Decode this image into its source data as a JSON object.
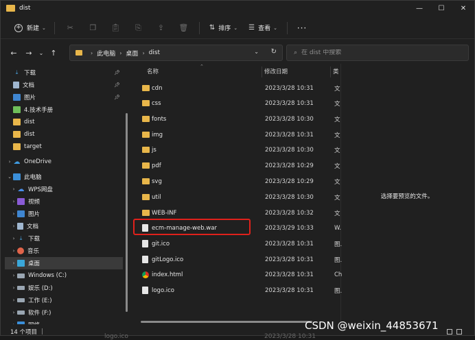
{
  "window": {
    "title": "dist",
    "controls": {
      "minimize": "—",
      "maximize": "☐",
      "close": "✕"
    }
  },
  "toolbar": {
    "new_label": "新建",
    "sort_label": "排序",
    "view_label": "查看",
    "more_label": "···"
  },
  "navigation": {
    "breadcrumb": [
      "此电脑",
      "桌面",
      "dist"
    ],
    "search_placeholder": "在 dist 中搜索"
  },
  "sidebar": {
    "quick_access": [
      {
        "label": "下载",
        "pinned": true
      },
      {
        "label": "文档",
        "pinned": true
      },
      {
        "label": "图片",
        "pinned": true
      },
      {
        "label": "4.技术手册",
        "pinned": false
      },
      {
        "label": "dist",
        "pinned": false
      },
      {
        "label": "dist",
        "pinned": false
      },
      {
        "label": "target",
        "pinned": false
      }
    ],
    "onedrive": "OneDrive",
    "this_pc": "此电脑",
    "pc_items": [
      "WPS网盘",
      "视频",
      "图片",
      "文档",
      "下载",
      "音乐",
      "桌面",
      "Windows (C:)",
      "娱乐 (D:)",
      "工作 (E:)",
      "软件 (F:)",
      "网络"
    ],
    "selected": "桌面"
  },
  "columns": {
    "name": "名称",
    "date": "修改日期",
    "type": "类"
  },
  "files": [
    {
      "name": "cdn",
      "date": "2023/3/28 10:31",
      "type": "文",
      "kind": "folder"
    },
    {
      "name": "css",
      "date": "2023/3/28 10:31",
      "type": "文",
      "kind": "folder"
    },
    {
      "name": "fonts",
      "date": "2023/3/28 10:30",
      "type": "文",
      "kind": "folder"
    },
    {
      "name": "img",
      "date": "2023/3/28 10:31",
      "type": "文",
      "kind": "folder"
    },
    {
      "name": "js",
      "date": "2023/3/28 10:30",
      "type": "文",
      "kind": "folder"
    },
    {
      "name": "pdf",
      "date": "2023/3/28 10:29",
      "type": "文",
      "kind": "folder"
    },
    {
      "name": "svg",
      "date": "2023/3/28 10:29",
      "type": "文",
      "kind": "folder"
    },
    {
      "name": "util",
      "date": "2023/3/28 10:30",
      "type": "文",
      "kind": "folder"
    },
    {
      "name": "WEB-INF",
      "date": "2023/3/28 10:32",
      "type": "文",
      "kind": "folder"
    },
    {
      "name": "ecm-manage-web.war",
      "date": "2023/3/29 10:33",
      "type": "W.",
      "kind": "file"
    },
    {
      "name": "git.ico",
      "date": "2023/3/28 10:31",
      "type": "图.",
      "kind": "file"
    },
    {
      "name": "gitLogo.ico",
      "date": "2023/3/28 10:31",
      "type": "图.",
      "kind": "file"
    },
    {
      "name": "index.html",
      "date": "2023/3/28 10:31",
      "type": "Ch",
      "kind": "chrome"
    },
    {
      "name": "logo.ico",
      "date": "2023/3/28 10:31",
      "type": "图.",
      "kind": "file"
    }
  ],
  "preview": {
    "message": "选择要预览的文件。"
  },
  "status": {
    "item_count": "14 个项目",
    "sep": "|"
  },
  "background": {
    "behind_name": "logo.ico",
    "behind_date": "2023/3/28 10:31"
  },
  "watermark": "CSDN @weixin_44853671",
  "colors": {
    "folder": "#e8b64a",
    "highlight": "#e0211b",
    "window_bg": "#202020"
  }
}
